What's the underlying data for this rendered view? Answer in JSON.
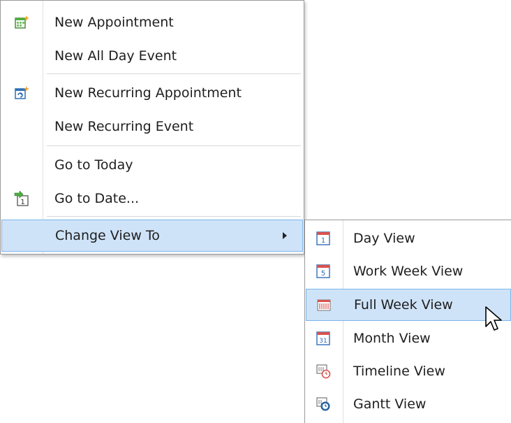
{
  "main_menu": {
    "items": [
      {
        "label": "New Appointment",
        "icon": "new-appointment-icon"
      },
      {
        "label": "New All Day Event",
        "icon": ""
      },
      {
        "label": "New Recurring Appointment",
        "icon": "recurring-appointment-icon"
      },
      {
        "label": "New Recurring Event",
        "icon": ""
      },
      {
        "label": "Go to Today",
        "icon": ""
      },
      {
        "label": "Go to Date...",
        "icon": "go-to-date-icon"
      },
      {
        "label": "Change View To",
        "icon": "",
        "has_submenu": true,
        "highlighted": true
      }
    ]
  },
  "submenu": {
    "items": [
      {
        "label": "Day View",
        "icon": "day-view-icon",
        "icon_text": "1"
      },
      {
        "label": "Work Week View",
        "icon": "work-week-view-icon",
        "icon_text": "5"
      },
      {
        "label": "Full Week View",
        "icon": "full-week-view-icon",
        "highlighted": true
      },
      {
        "label": "Month View",
        "icon": "month-view-icon",
        "icon_text": "31"
      },
      {
        "label": "Timeline View",
        "icon": "timeline-view-icon"
      },
      {
        "label": "Gantt View",
        "icon": "gantt-view-icon"
      }
    ]
  },
  "colors": {
    "highlight_bg": "#cfe3f8",
    "highlight_border": "#7db4e8",
    "calendar_red": "#d9534f",
    "calendar_blue": "#2f6fb7",
    "icon_green": "#4caf3f"
  }
}
